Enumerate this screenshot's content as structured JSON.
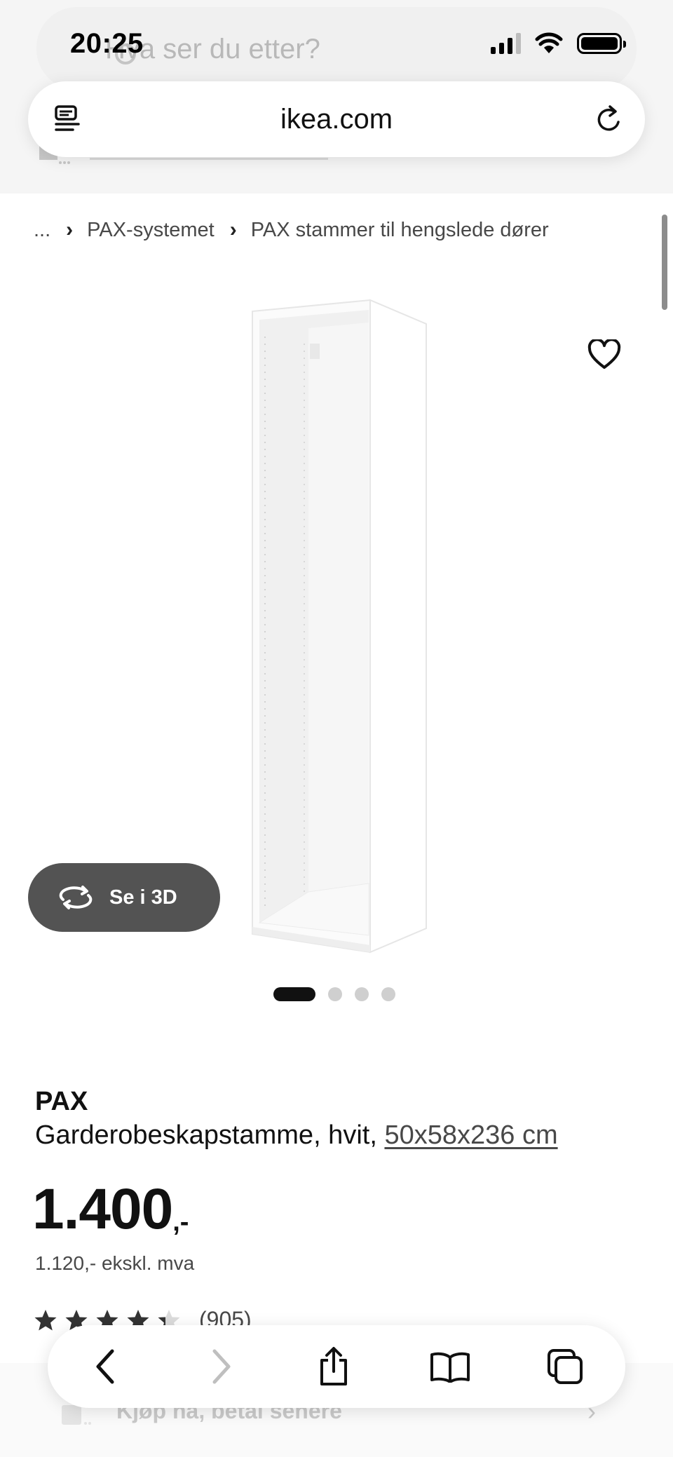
{
  "status_bar": {
    "time": "20:25"
  },
  "background_header": {
    "search_placeholder": "Hva ser du etter?"
  },
  "address_bar": {
    "url": "ikea.com"
  },
  "breadcrumb": {
    "ellipsis": "...",
    "items": [
      "PAX-systemet",
      "PAX stammer til hengslede dører"
    ]
  },
  "product": {
    "name": "PAX",
    "description": "Garderobeskapstamme, hvit,",
    "dimensions": "50x58x236 cm",
    "price_main": "1.400",
    "price_suffix": ",-",
    "price_excl_vat": "1.120,- ekskl. mva",
    "rating_value": 4.3,
    "rating_max": 5,
    "review_count": "(905)"
  },
  "view_3d": {
    "label": "Se i 3D"
  },
  "carousel": {
    "total": 4,
    "active_index": 0
  },
  "background_footer": {
    "bnpl_text": "Kjøp nå, betal senere"
  },
  "colors": {
    "accent_dark": "#111111",
    "view_3d_bg": "#535353",
    "secondary_text": "#484848",
    "star_color": "#333333",
    "star_empty": "#dcdcdc"
  }
}
